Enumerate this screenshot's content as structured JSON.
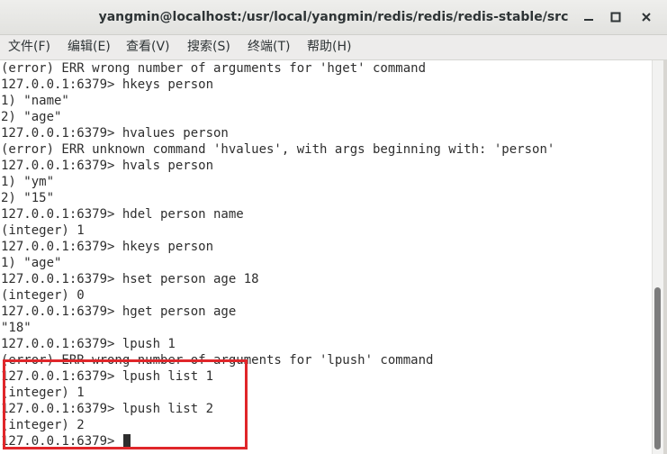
{
  "window": {
    "title": "yangmin@localhost:/usr/local/yangmin/redis/redis/redis-stable/src"
  },
  "menu": [
    {
      "label": "文件(F)"
    },
    {
      "label": "编辑(E)"
    },
    {
      "label": "查看(V)"
    },
    {
      "label": "搜索(S)"
    },
    {
      "label": "终端(T)"
    },
    {
      "label": "帮助(H)"
    }
  ],
  "terminal": {
    "lines": [
      "(error) ERR wrong number of arguments for 'hget' command",
      "127.0.0.1:6379> hkeys person",
      "1) \"name\"",
      "2) \"age\"",
      "127.0.0.1:6379> hvalues person",
      "(error) ERR unknown command 'hvalues', with args beginning with: 'person'",
      "127.0.0.1:6379> hvals person",
      "1) \"ym\"",
      "2) \"15\"",
      "127.0.0.1:6379> hdel person name",
      "(integer) 1",
      "127.0.0.1:6379> hkeys person",
      "1) \"age\"",
      "127.0.0.1:6379> hset person age 18",
      "(integer) 0",
      "127.0.0.1:6379> hget person age",
      "\"18\"",
      "127.0.0.1:6379> lpush 1",
      "(error) ERR wrong number of arguments for 'lpush' command",
      "127.0.0.1:6379> lpush list 1",
      "(integer) 1",
      "127.0.0.1:6379> lpush list 2",
      "(integer) 2",
      "127.0.0.1:6379> "
    ]
  },
  "colors": {
    "highlight": "#e0262a",
    "terminal_text": "#2e2e2e",
    "terminal_bg": "#ffffff"
  }
}
